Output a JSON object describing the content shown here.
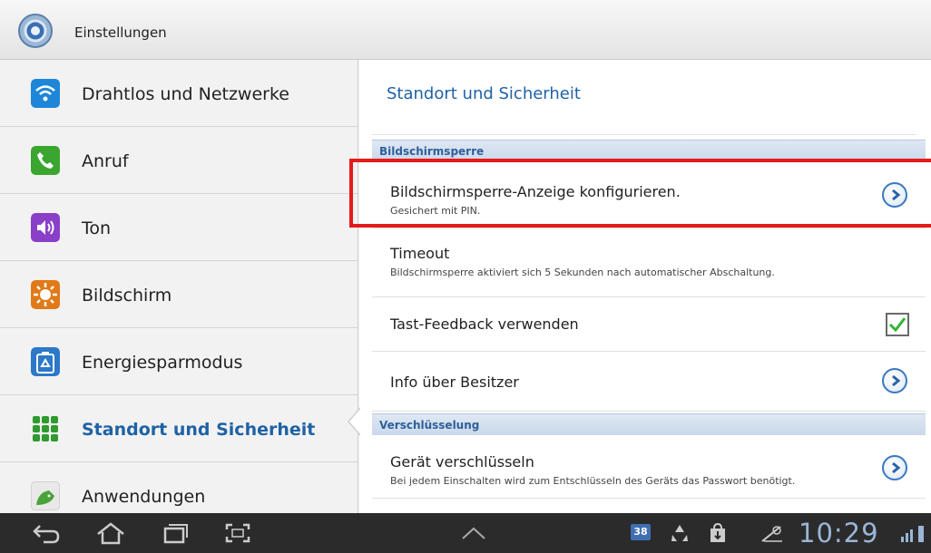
{
  "app": {
    "title": "Einstellungen",
    "icon": "gear-icon"
  },
  "sidebar": {
    "items": [
      {
        "label": "Drahtlos und Netzwerke",
        "icon": "wifi-icon",
        "color": "#1e86d8",
        "active": false
      },
      {
        "label": "Anruf",
        "icon": "phone-icon",
        "color": "#3aa62f",
        "active": false
      },
      {
        "label": "Ton",
        "icon": "speaker-icon",
        "color": "#8a3fc8",
        "active": false
      },
      {
        "label": "Bildschirm",
        "icon": "brightness-icon",
        "color": "#e07a18",
        "active": false
      },
      {
        "label": "Energiesparmodus",
        "icon": "battery-recycle-icon",
        "color": "#2d78c8",
        "active": false
      },
      {
        "label": "Standort und Sicherheit",
        "icon": "location-grid-icon",
        "color": "#2f9a2f",
        "active": true
      },
      {
        "label": "Anwendungen",
        "icon": "android-icon",
        "color": "#4aa23a",
        "active": false
      }
    ]
  },
  "main": {
    "title": "Standort und Sicherheit",
    "sections": [
      {
        "header": "Bildschirmsperre",
        "rows": [
          {
            "title": "Bildschirmsperre-Anzeige konfigurieren.",
            "subtitle": "Gesichert mit PIN.",
            "control": "chevron"
          },
          {
            "title": "Timeout",
            "subtitle": "Bildschirmsperre aktiviert sich 5 Sekunden nach automatischer Abschaltung.",
            "control": "none"
          },
          {
            "title": "Tast-Feedback verwenden",
            "subtitle": "",
            "control": "checkbox",
            "checked": true
          },
          {
            "title": "Info über Besitzer",
            "subtitle": "",
            "control": "chevron"
          }
        ]
      },
      {
        "header": "Verschlüsselung",
        "rows": [
          {
            "title": "Gerät verschlüsseln",
            "subtitle": "Bei jedem Einschalten wird zum Entschlüsseln des Geräts das Passwort benötigt.",
            "control": "chevron"
          }
        ]
      }
    ]
  },
  "navbar": {
    "buttons": [
      "back-icon",
      "home-icon",
      "recent-apps-icon",
      "screenshot-icon",
      "up-chevron-icon"
    ],
    "status": {
      "calendar_badge": "38",
      "time": "10:29"
    }
  },
  "colors": {
    "accent": "#1f62a5",
    "highlight": "#e41b1b",
    "nav_bg": "#2b2b2b",
    "clock": "#9ab6d7"
  }
}
